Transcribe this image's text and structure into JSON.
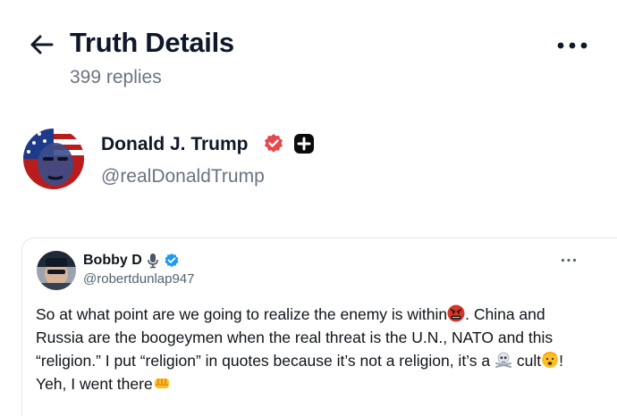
{
  "header": {
    "title": "Truth Details",
    "replies": "399 replies",
    "back_icon": "arrow-left-icon",
    "more_icon": "more-horizontal-icon"
  },
  "author": {
    "name": "Donald J. Trump",
    "handle": "@realDonaldTrump",
    "verified_color": "#e5484d",
    "plus_badge_color": "#0b0b0b"
  },
  "quoted_post": {
    "name": "Bobby D",
    "handle": "@robertdunlap947",
    "verified_color": "#1d9bf0",
    "text_part1": "So at what point are we going to realize the enemy is within",
    "text_part2": ". China and Russia are the boogeymen when the real threat is the U.N., NATO and this “religion.” I put “religion” in quotes because it’s not a religion, it’s a ",
    "text_part3": " cult",
    "text_part4": "! Yeh, I went there"
  }
}
